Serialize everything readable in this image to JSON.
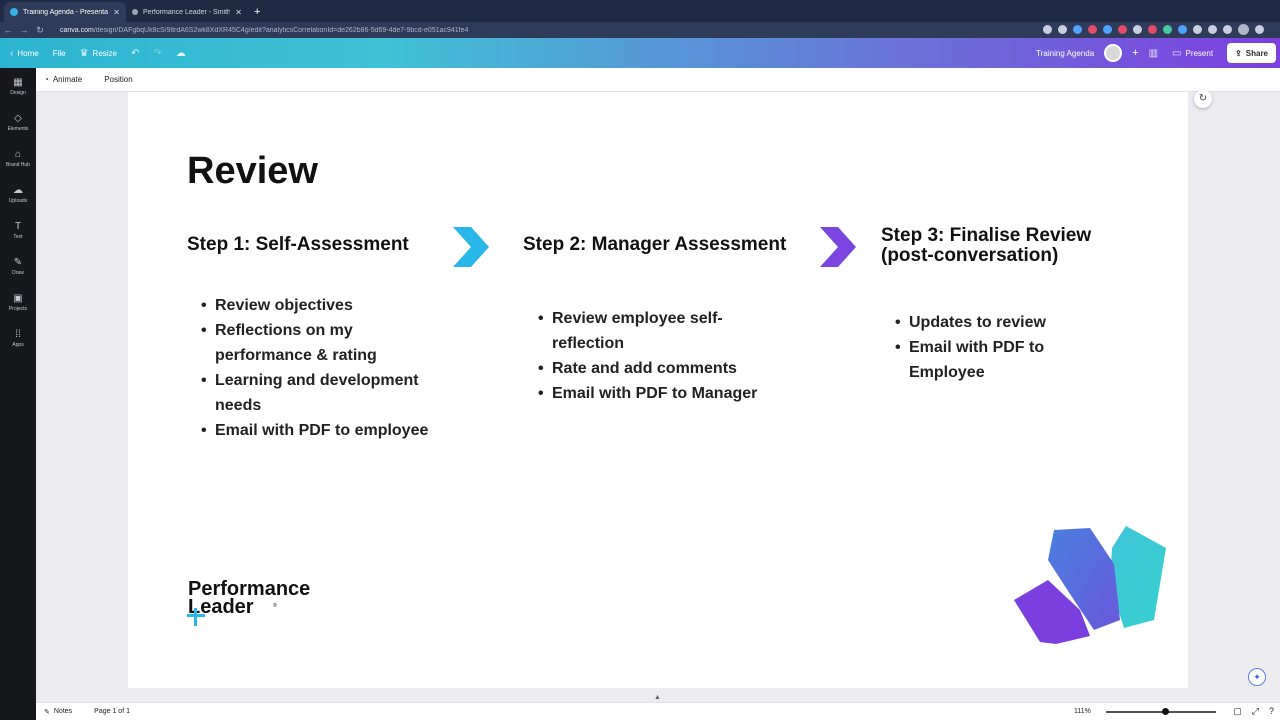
{
  "browser": {
    "tabs": [
      {
        "title": "Training Agenda - Presentation",
        "active": true
      },
      {
        "title": "Performance Leader - Smith &",
        "active": false
      }
    ],
    "url_host": "canva.com",
    "url_path": "/design/DAFgbqUk8cS/9ltrdA6S2wk8XdXR45C4g/edit?analyticsCorrelationId=de262b86-5d69-4de7-9bcd-e051ac941fe4"
  },
  "toolbar": {
    "home": "Home",
    "file": "File",
    "resize": "Resize",
    "doc_title": "Training Agenda",
    "present": "Present",
    "share": "Share"
  },
  "sidebar": {
    "items": [
      {
        "label": "Design",
        "icon": "design-icon"
      },
      {
        "label": "Elements",
        "icon": "elements-icon"
      },
      {
        "label": "Brand Hub",
        "icon": "brand-hub-icon"
      },
      {
        "label": "Uploads",
        "icon": "uploads-icon"
      },
      {
        "label": "Text",
        "icon": "text-icon"
      },
      {
        "label": "Draw",
        "icon": "draw-icon"
      },
      {
        "label": "Projects",
        "icon": "projects-icon"
      },
      {
        "label": "Apps",
        "icon": "apps-icon"
      }
    ]
  },
  "context": {
    "animate": "Animate",
    "position": "Position"
  },
  "slide": {
    "title": "Review",
    "steps": [
      {
        "heading": "Step 1: Self-Assessment",
        "bullets": [
          "Review objectives",
          "Reflections on my performance & rating",
          "Learning and development needs",
          "Email with PDF to employee"
        ]
      },
      {
        "heading": "Step 2: Manager Assessment",
        "bullets": [
          "Review employee self-reflection",
          "Rate and add comments",
          "Email with PDF to Manager"
        ]
      },
      {
        "heading": "Step 3: Finalise Review (post-conversation)",
        "bullets": [
          "Updates to review",
          "Email with PDF to Employee"
        ]
      }
    ],
    "logo_line1": "Performance",
    "logo_line2": "Leader",
    "colors": {
      "chevron1": "#29b6e8",
      "chevron2": "#7b45e0",
      "accent_cross": "#29b6e8"
    }
  },
  "bottom": {
    "notes": "Notes",
    "page": "Page 1 of 1",
    "zoom": "111%"
  }
}
